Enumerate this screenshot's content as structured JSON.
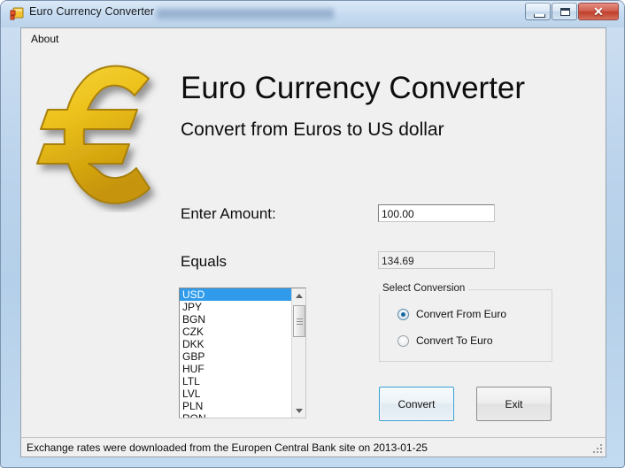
{
  "window": {
    "title": "Euro Currency Converter",
    "icon": "application-form-icon",
    "controls": {
      "minimize": "minimize-icon",
      "maximize": "maximize-icon",
      "close": "✕"
    }
  },
  "menu": {
    "items": [
      {
        "label": "About",
        "name": "menu-item-about"
      }
    ]
  },
  "branding": {
    "logo": "euro-symbol-logo",
    "title": "Euro Currency Converter",
    "subtitle": "Convert from Euros to US dollar",
    "logo_color_light": "#f2c91e",
    "logo_color_dark": "#c99a08"
  },
  "form": {
    "amount_label": "Enter Amount:",
    "amount_value": "100.00",
    "amount_placeholder": "",
    "equals_label": "Equals",
    "equals_value": "134.69"
  },
  "currency_list": {
    "selected": "USD",
    "items": [
      "USD",
      "JPY",
      "BGN",
      "CZK",
      "DKK",
      "GBP",
      "HUF",
      "LTL",
      "LVL",
      "PLN",
      "RON"
    ],
    "selection_color": "#2f9bea",
    "scrollbar": {
      "up_arrow": "scroll-up-icon",
      "down_arrow": "scroll-down-icon"
    }
  },
  "conversion_group": {
    "title": "Select Conversion",
    "options": [
      {
        "label": "Convert From Euro",
        "checked": true
      },
      {
        "label": "Convert To Euro",
        "checked": false
      }
    ],
    "radio_accent": "#14689e"
  },
  "actions": {
    "convert_label": "Convert",
    "exit_label": "Exit",
    "focus_color": "#3c9fd4"
  },
  "statusbar": {
    "message": "Exchange rates were downloaded from the Europen Central Bank site on 2013-01-25",
    "grip": "resize-grip-icon"
  }
}
